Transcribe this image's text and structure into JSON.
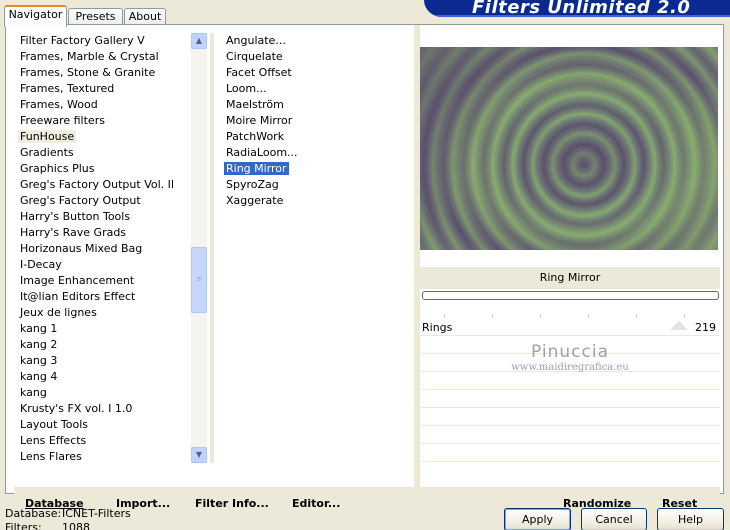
{
  "app": {
    "logo_text": "Filters Unlimited 2.0"
  },
  "tabs": [
    {
      "label": "Navigator",
      "active": true
    },
    {
      "label": "Presets",
      "active": false
    },
    {
      "label": "About",
      "active": false
    }
  ],
  "categories": [
    "Filter Factory Gallery V",
    "Frames, Marble & Crystal",
    "Frames, Stone & Granite",
    "Frames, Textured",
    "Frames, Wood",
    "Freeware filters",
    "FunHouse",
    "Gradients",
    "Graphics Plus",
    "Greg's Factory Output Vol. II",
    "Greg's Factory Output",
    "Harry's Button Tools",
    "Harry's Rave Grads",
    "Horizonaus Mixed Bag",
    "I-Decay",
    "Image Enhancement",
    "It@lian Editors Effect",
    "Jeux de lignes",
    "kang 1",
    "kang 2",
    "kang 3",
    "kang 4",
    "kang",
    "Krusty's FX vol. I 1.0",
    "Layout Tools",
    "Lens Effects",
    "Lens Flares"
  ],
  "selected_category": "FunHouse",
  "filters": [
    "Angulate...",
    "Cirquelate",
    "Facet Offset",
    "Loom...",
    "Maelström",
    "Moire Mirror",
    "PatchWork",
    "RadiaLoom...",
    "Ring Mirror",
    "SpyroZag",
    "Xaggerate"
  ],
  "selected_filter": "Ring Mirror",
  "preview": {
    "filter_name": "Ring Mirror",
    "colors": {
      "purple": "#5a4e6a",
      "green": "#8aae6c"
    }
  },
  "controls": [
    {
      "label": "Rings",
      "value": "219"
    }
  ],
  "watermark": {
    "line1": "Pinuccia",
    "line2": "www.maidiregrafica.eu"
  },
  "bottom_links": {
    "database": "Database",
    "import": "Import...",
    "filter_info": "Filter Info...",
    "editor": "Editor...",
    "randomize": "Randomize",
    "reset": "Reset"
  },
  "footer": {
    "database_label": "Database:",
    "database_value": "ICNET-Filters",
    "filters_label": "Filters:",
    "filters_value": "1088"
  },
  "buttons": {
    "apply": "Apply",
    "cancel": "Cancel",
    "help": "Help"
  },
  "icons": {
    "scroll_up": "▲",
    "scroll_down": "▼",
    "scroll_grip": "≡"
  }
}
